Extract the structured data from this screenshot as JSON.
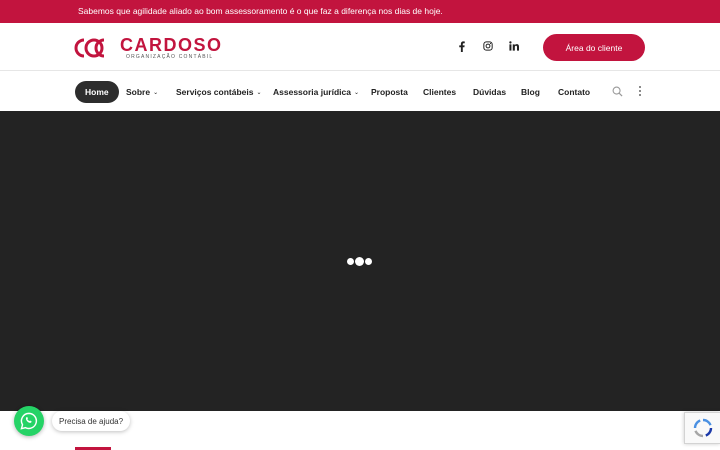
{
  "topbar": {
    "message": "Sabemos que agilidade aliado ao bom assessoramento é o que faz a diferença nos dias de hoje."
  },
  "brand": {
    "name": "CARDOSO",
    "tagline": "ORGANIZAÇÃO CONTÁBIL",
    "accent_color": "#c2143e"
  },
  "header": {
    "social_icons": [
      "facebook-icon",
      "instagram-icon",
      "linkedin-icon"
    ],
    "client_button_label": "Área do cliente"
  },
  "nav": {
    "items": [
      {
        "label": "Home",
        "active": true
      },
      {
        "label": "Sobre",
        "dropdown": true
      },
      {
        "label": "Serviços contábeis",
        "dropdown": true
      },
      {
        "label": "Assessoria jurídica",
        "dropdown": true
      },
      {
        "label": "Proposta"
      },
      {
        "label": "Clientes"
      },
      {
        "label": "Dúvidas"
      },
      {
        "label": "Blog"
      },
      {
        "label": "Contato"
      }
    ],
    "caret": "⌄",
    "icons": [
      "search-icon",
      "more-vertical-icon"
    ]
  },
  "hero": {
    "background": "#232323",
    "loader": "loading-dots-icon"
  },
  "whatsapp": {
    "tooltip": "Precisa de ajuda?",
    "color": "#25d366"
  },
  "recaptcha": {
    "icon": "recaptcha-icon"
  }
}
